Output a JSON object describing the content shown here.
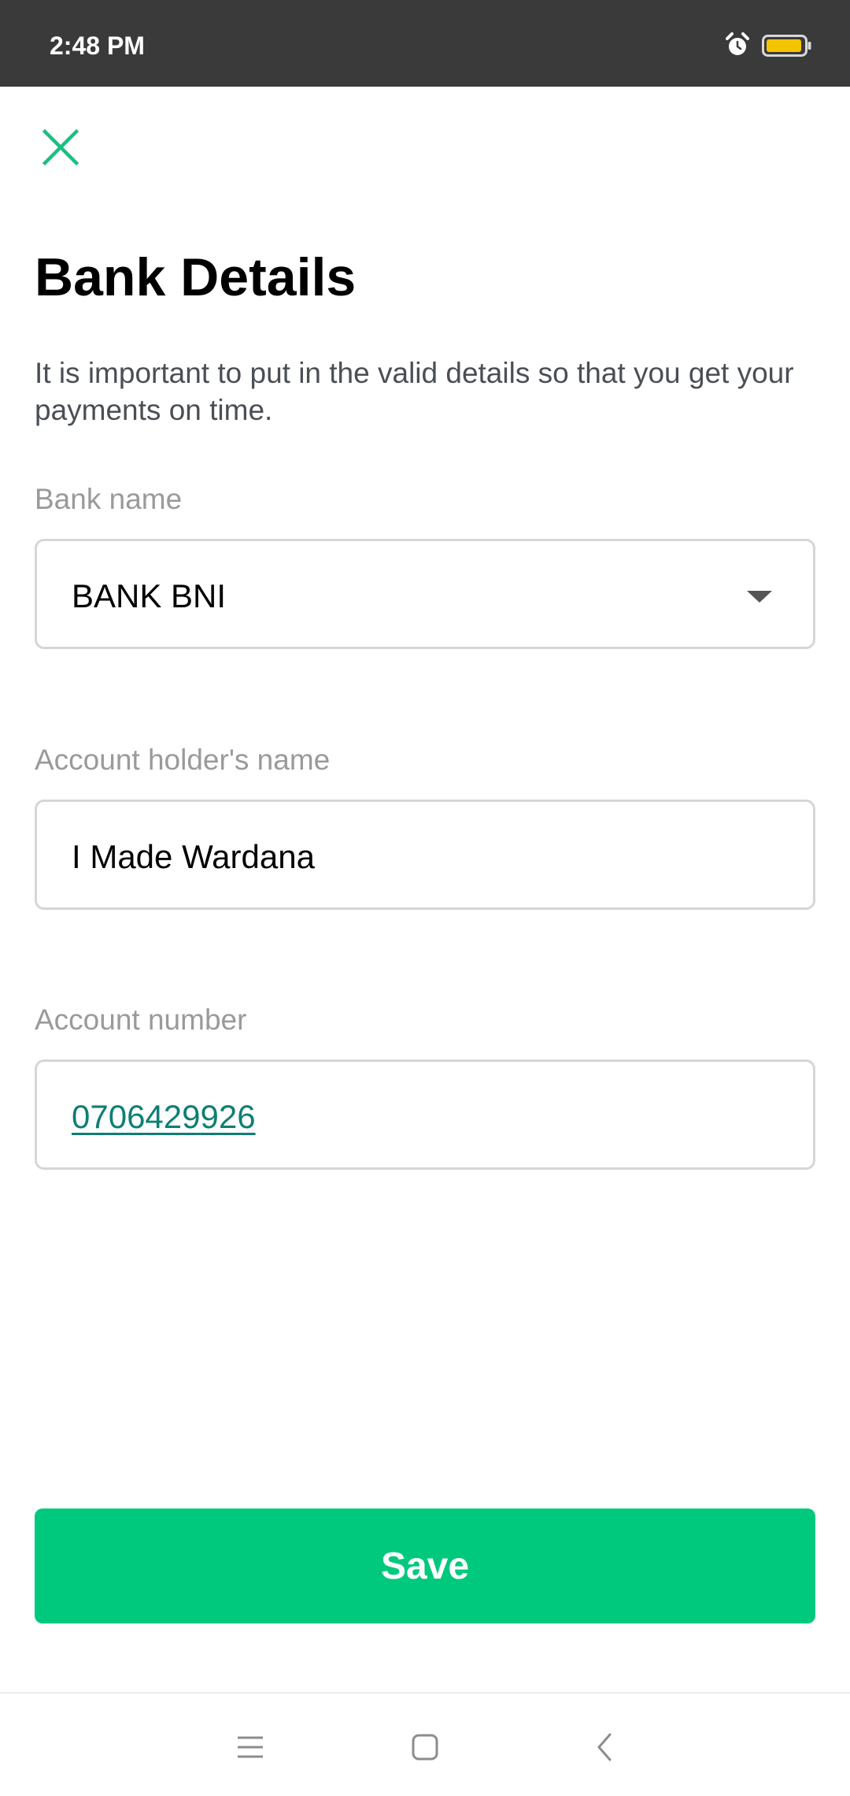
{
  "status_bar": {
    "time": "2:48 PM",
    "icons": [
      "alarm-icon",
      "battery-icon"
    ],
    "battery_color": "#f5c400"
  },
  "header": {
    "close_icon": "close-icon",
    "title": "Bank Details",
    "description": "It is important to put in the valid details so that you get your payments on time."
  },
  "form": {
    "bank_name": {
      "label": "Bank name",
      "value": "BANK BNI"
    },
    "account_holder": {
      "label": "Account holder's name",
      "value": "I Made Wardana"
    },
    "account_number": {
      "label": "Account number",
      "value": "0706429926"
    }
  },
  "actions": {
    "save_label": "Save"
  },
  "nav_bar": {
    "icons": [
      "menu-icon",
      "home-icon",
      "back-icon"
    ]
  },
  "colors": {
    "accent": "#00c97e",
    "close_icon": "#1bbf82",
    "link": "#0e7f73",
    "status_bar": "#3a3a3a"
  }
}
